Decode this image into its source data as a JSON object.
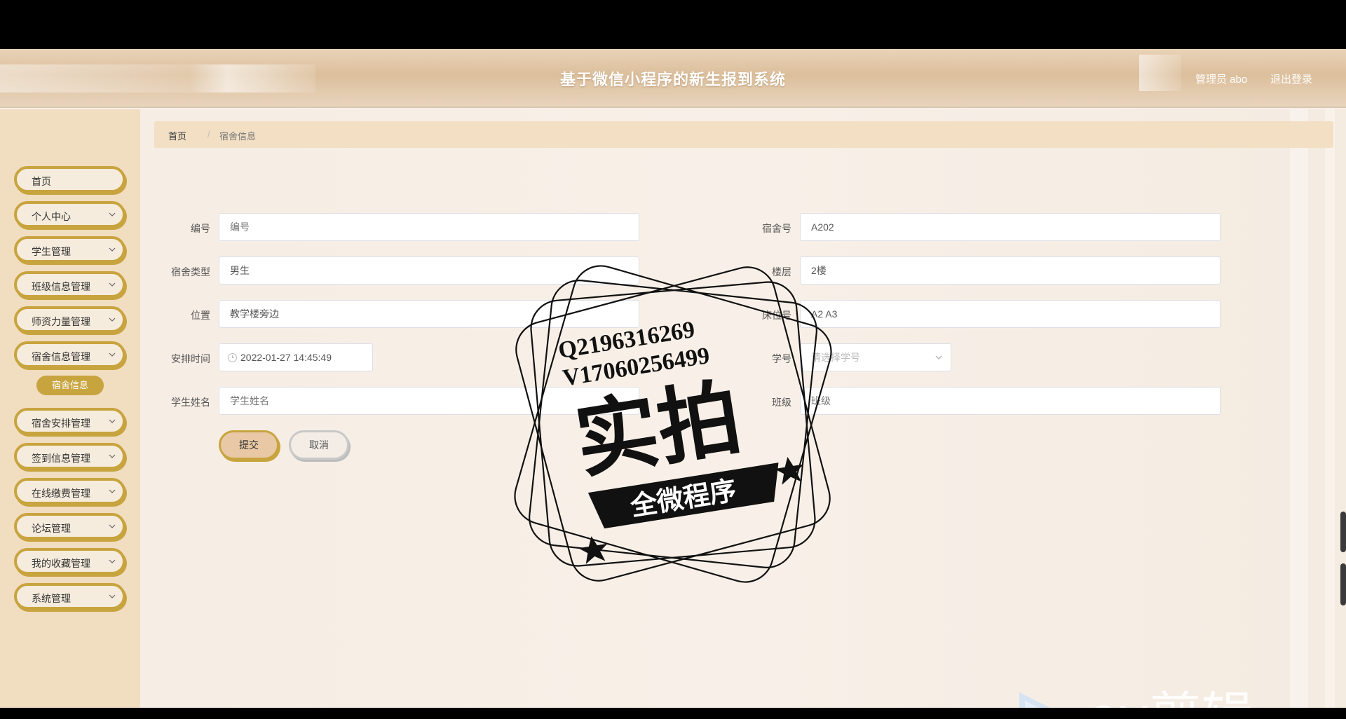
{
  "header": {
    "title": "基于微信小程序的新生报到系统",
    "user": "管理员 abo",
    "logout": "退出登录"
  },
  "sidebar": {
    "items": [
      {
        "label": "首页",
        "has_chevron": false
      },
      {
        "label": "个人中心",
        "has_chevron": true
      },
      {
        "label": "学生管理",
        "has_chevron": true
      },
      {
        "label": "班级信息管理",
        "has_chevron": true
      },
      {
        "label": "师资力量管理",
        "has_chevron": true
      },
      {
        "label": "宿舍信息管理",
        "has_chevron": true
      },
      {
        "label": "宿舍安排管理",
        "has_chevron": true
      },
      {
        "label": "签到信息管理",
        "has_chevron": true
      },
      {
        "label": "在线缴费管理",
        "has_chevron": true
      },
      {
        "label": "论坛管理",
        "has_chevron": true
      },
      {
        "label": "我的收藏管理",
        "has_chevron": true
      },
      {
        "label": "系统管理",
        "has_chevron": true
      }
    ],
    "active_sub": "宿舍信息"
  },
  "breadcrumb": {
    "home": "首页",
    "separator": "/",
    "current": "宿舍信息"
  },
  "form": {
    "bianhao": {
      "label": "编号",
      "value": "",
      "placeholder": "编号"
    },
    "sushehao": {
      "label": "宿舍号",
      "value": "A202"
    },
    "sushe_leixing": {
      "label": "宿舍类型",
      "value": "男生"
    },
    "louceng": {
      "label": "楼层",
      "value": "2楼"
    },
    "weizhi": {
      "label": "位置",
      "value": "教学楼旁边"
    },
    "chuangweihao": {
      "label": "床位号",
      "value": "A2 A3"
    },
    "anpai_shijian": {
      "label": "安排时间",
      "value": "2022-01-27 14:45:49"
    },
    "xuehao": {
      "label": "学号",
      "value": "",
      "placeholder": "请选择学号"
    },
    "xuesheng_xingming": {
      "label": "学生姓名",
      "value": "",
      "placeholder": "学生姓名"
    },
    "banji": {
      "label": "班级",
      "value": "",
      "placeholder": "班级"
    },
    "submit": "提交",
    "cancel": "取消"
  },
  "watermark": {
    "line1": "Q2196316269",
    "line2": "V17060256499",
    "big_text": "实拍",
    "banner": "全微程序",
    "logo_text": "ev剪辑"
  },
  "colors": {
    "accent_gold": "#c8a43f",
    "sidebar_bg": "#f1ddc0",
    "header_bg": "#dcbf9c",
    "breadcrumb_bg": "#f2dfc4"
  },
  "icons": {
    "chevron": "chevron-down-icon",
    "clock": "clock-icon",
    "select_arrow": "chevron-down-icon"
  }
}
